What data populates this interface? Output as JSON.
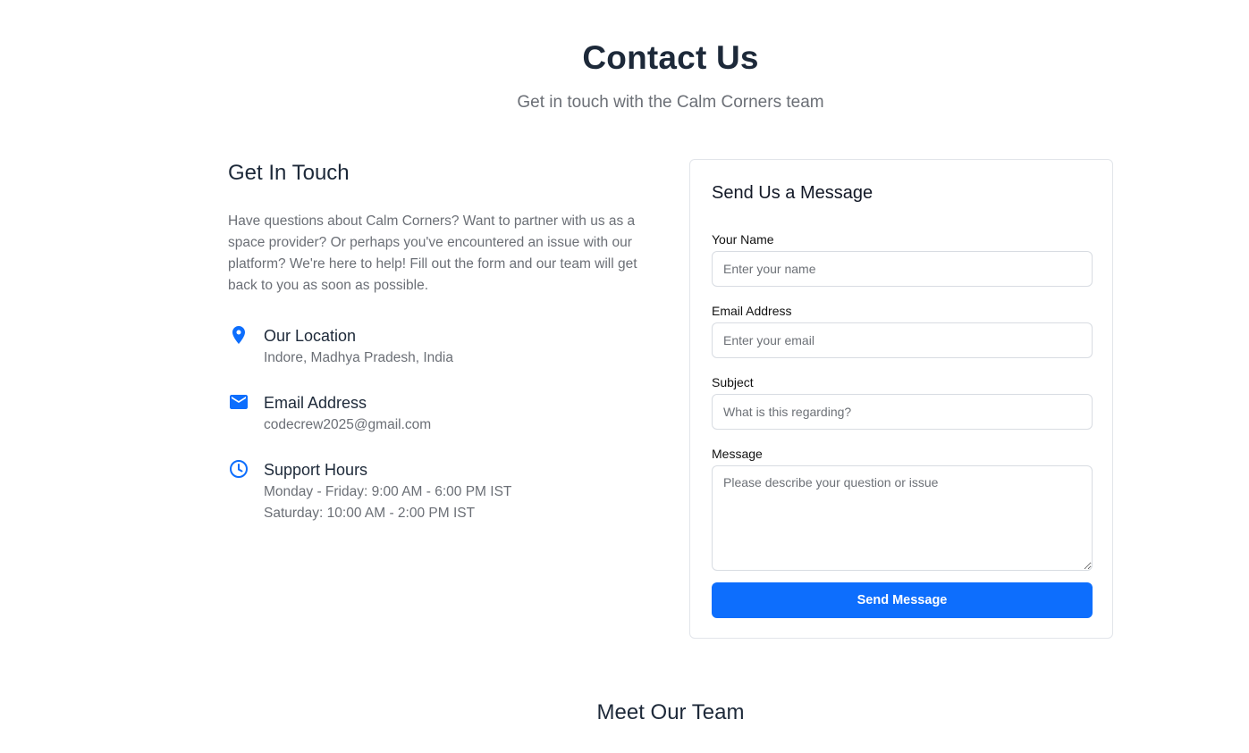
{
  "header": {
    "title": "Contact Us",
    "subtitle": "Get in touch with the Calm Corners team"
  },
  "contact_info": {
    "heading": "Get In Touch",
    "intro": "Have questions about Calm Corners? Want to partner with us as a space provider? Or perhaps you've encountered an issue with our platform? We're here to help! Fill out the form and our team will get back to you as soon as possible.",
    "location": {
      "icon": "map-pin-icon",
      "title": "Our Location",
      "value": "Indore, Madhya Pradesh, India"
    },
    "email": {
      "icon": "envelope-icon",
      "title": "Email Address",
      "value": "codecrew2025@gmail.com"
    },
    "hours": {
      "icon": "clock-icon",
      "title": "Support Hours",
      "weekdays": "Monday - Friday: 9:00 AM - 6:00 PM IST",
      "saturday": "Saturday: 10:00 AM - 2:00 PM IST"
    }
  },
  "form": {
    "title": "Send Us a Message",
    "name": {
      "label": "Your Name",
      "value": "",
      "placeholder": "Enter your name"
    },
    "email": {
      "label": "Email Address",
      "value": "",
      "placeholder": "Enter your email"
    },
    "subject": {
      "label": "Subject",
      "value": "",
      "placeholder": "What is this regarding?"
    },
    "message": {
      "label": "Message",
      "value": "",
      "placeholder": "Please describe your question or issue"
    },
    "submit_label": "Send Message"
  },
  "team": {
    "heading": "Meet Our Team"
  },
  "colors": {
    "accent": "#0d6efd",
    "heading": "#1d2939",
    "muted_text": "#6b6f76",
    "border": "#e2e5ea"
  }
}
